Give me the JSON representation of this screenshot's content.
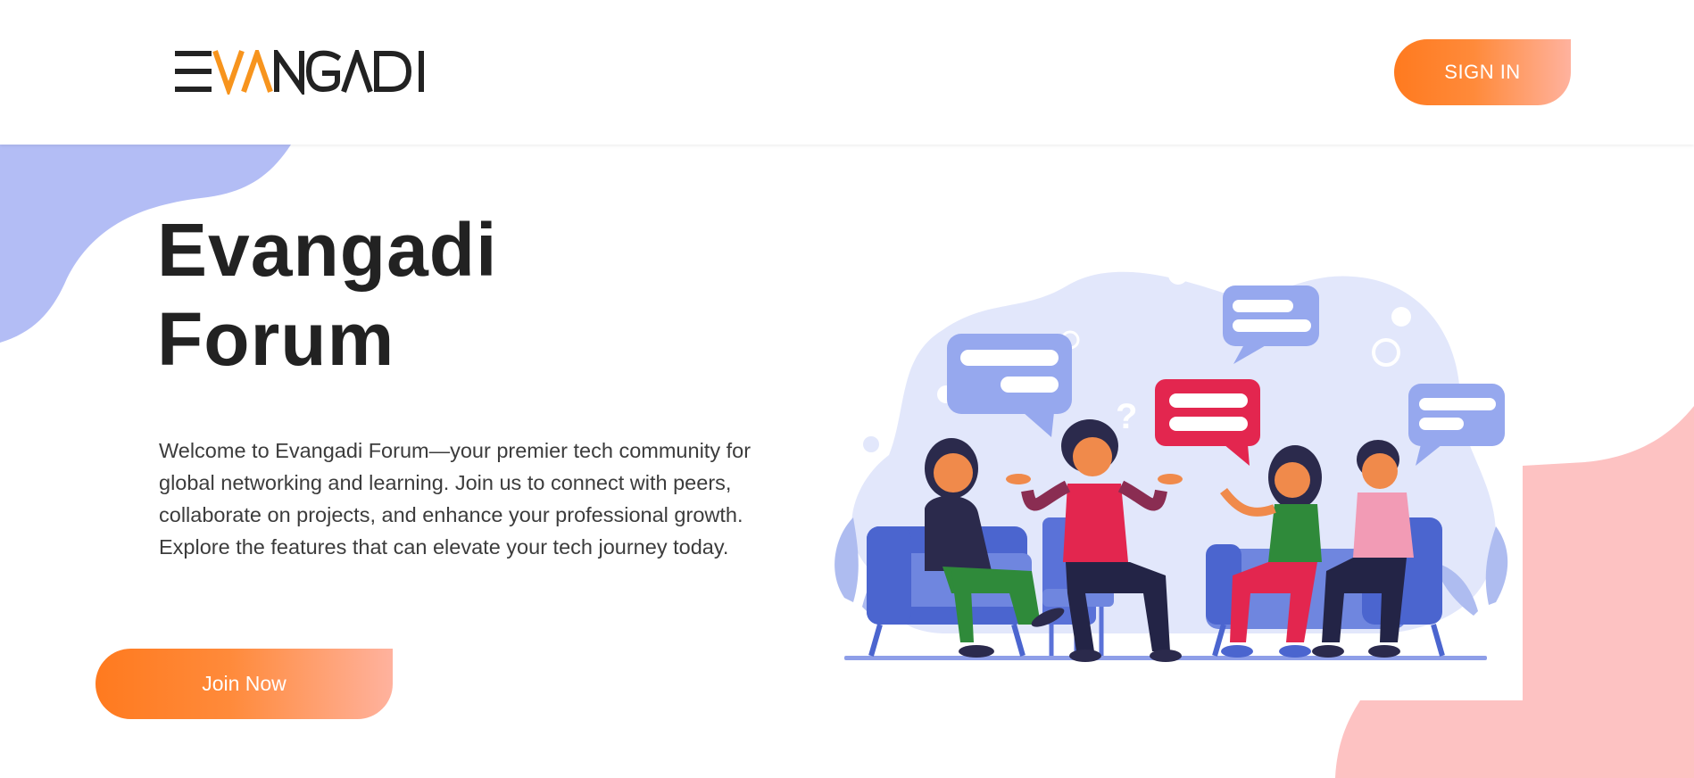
{
  "header": {
    "logo_text": "EVANGADI",
    "sign_in_label": "SIGN IN"
  },
  "hero": {
    "title_line1": "Evangadi",
    "title_line2": "Forum",
    "description": "Welcome to Evangadi Forum—your premier tech community for global networking and learning. Join us to connect with peers, collaborate on projects, and enhance your professional growth. Explore the features that can elevate your tech journey today.",
    "join_label": "Join Now"
  },
  "colors": {
    "accent_orange": "#ff7a1f",
    "accent_peach": "#ffb29e",
    "blob_blue": "#b3bdf5",
    "blob_pink": "#fdc2c2",
    "title": "#222222"
  },
  "illustration": {
    "icon": "people-discussion-illustration"
  }
}
